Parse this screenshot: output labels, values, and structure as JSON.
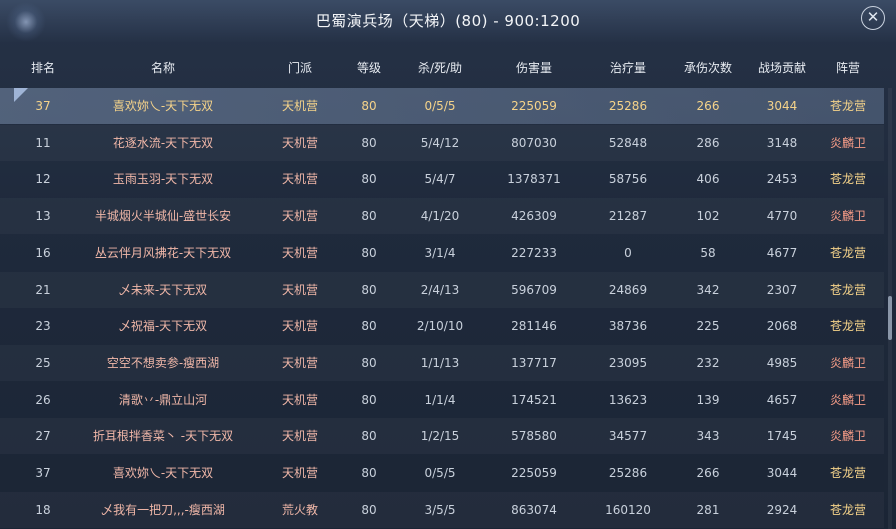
{
  "window": {
    "title": "巴蜀演兵场（天梯）(80) - 900:1200"
  },
  "columns": [
    "排名",
    "名称",
    "门派",
    "等级",
    "杀/死/助",
    "伤害量",
    "治疗量",
    "承伤次数",
    "战场贡献",
    "阵营"
  ],
  "rows": [
    {
      "rank": "37",
      "name": "喜欢妳乀-天下无双",
      "sect": "天机营",
      "level": "80",
      "kda": "0/5/5",
      "damage": "225059",
      "heal": "25286",
      "hits": "266",
      "contrib": "3044",
      "faction": "苍龙营"
    },
    {
      "rank": "11",
      "name": "花逐水流-天下无双",
      "sect": "天机营",
      "level": "80",
      "kda": "5/4/12",
      "damage": "807030",
      "heal": "52848",
      "hits": "286",
      "contrib": "3148",
      "faction": "炎麟卫"
    },
    {
      "rank": "12",
      "name": "玉雨玉羽-天下无双",
      "sect": "天机营",
      "level": "80",
      "kda": "5/4/7",
      "damage": "1378371",
      "heal": "58756",
      "hits": "406",
      "contrib": "2453",
      "faction": "苍龙营"
    },
    {
      "rank": "13",
      "name": "半城烟火半城仙-盛世长安",
      "sect": "天机营",
      "level": "80",
      "kda": "4/1/20",
      "damage": "426309",
      "heal": "21287",
      "hits": "102",
      "contrib": "4770",
      "faction": "炎麟卫"
    },
    {
      "rank": "16",
      "name": "丛云伴月风拂花-天下无双",
      "sect": "天机营",
      "level": "80",
      "kda": "3/1/4",
      "damage": "227233",
      "heal": "0",
      "hits": "58",
      "contrib": "4677",
      "faction": "苍龙营"
    },
    {
      "rank": "21",
      "name": "乄未来-天下无双",
      "sect": "天机营",
      "level": "80",
      "kda": "2/4/13",
      "damage": "596709",
      "heal": "24869",
      "hits": "342",
      "contrib": "2307",
      "faction": "苍龙营"
    },
    {
      "rank": "23",
      "name": "乄祝福-天下无双",
      "sect": "天机营",
      "level": "80",
      "kda": "2/10/10",
      "damage": "281146",
      "heal": "38736",
      "hits": "225",
      "contrib": "2068",
      "faction": "苍龙营"
    },
    {
      "rank": "25",
      "name": "空空不想卖参-瘦西湖",
      "sect": "天机营",
      "level": "80",
      "kda": "1/1/13",
      "damage": "137717",
      "heal": "23095",
      "hits": "232",
      "contrib": "4985",
      "faction": "炎麟卫"
    },
    {
      "rank": "26",
      "name": "清歌丷-鼎立山河",
      "sect": "天机营",
      "level": "80",
      "kda": "1/1/4",
      "damage": "174521",
      "heal": "13623",
      "hits": "139",
      "contrib": "4657",
      "faction": "炎麟卫"
    },
    {
      "rank": "27",
      "name": "折耳根拌香菜丶 -天下无双",
      "sect": "天机营",
      "level": "80",
      "kda": "1/2/15",
      "damage": "578580",
      "heal": "34577",
      "hits": "343",
      "contrib": "1745",
      "faction": "炎麟卫"
    },
    {
      "rank": "37",
      "name": "喜欢妳乀-天下无双",
      "sect": "天机营",
      "level": "80",
      "kda": "0/5/5",
      "damage": "225059",
      "heal": "25286",
      "hits": "266",
      "contrib": "3044",
      "faction": "苍龙营"
    },
    {
      "rank": "18",
      "name": "乄我有一把刀,,,-瘦西湖",
      "sect": "荒火教",
      "level": "80",
      "kda": "3/5/5",
      "damage": "863074",
      "heal": "160120",
      "hits": "281",
      "contrib": "2924",
      "faction": "苍龙营"
    }
  ],
  "selected_row_index": 0,
  "colors": {
    "faction_a": "#f5d38a",
    "faction_b": "#f29a86",
    "name_red": "#f0b7a8"
  }
}
